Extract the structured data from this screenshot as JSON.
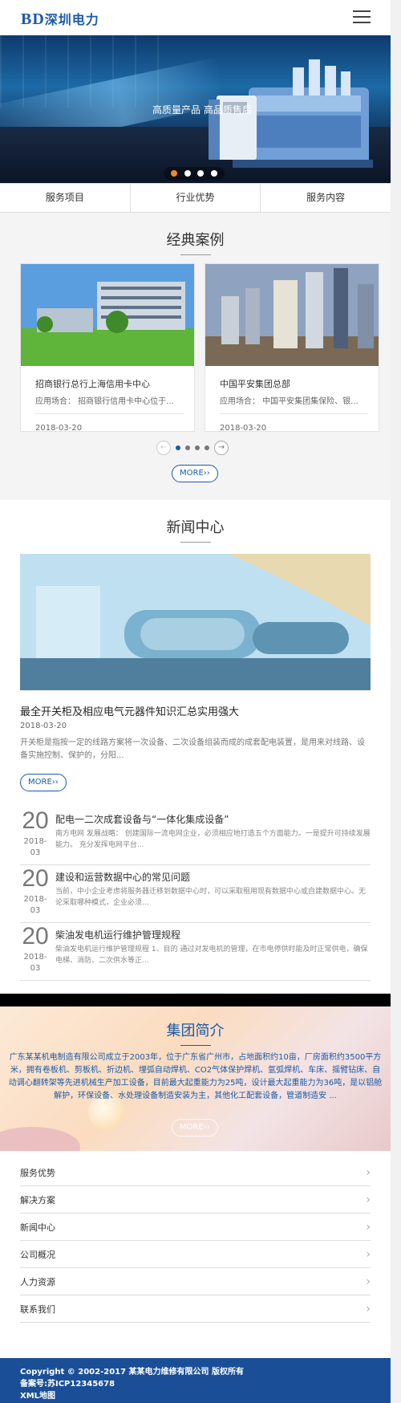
{
  "header": {
    "logo_latin": "BD",
    "logo_cn": "深圳电力"
  },
  "banner": {
    "tagline": "高质量产品 高品质售后",
    "slides": 5,
    "active_slide": 1
  },
  "tabs": [
    "服务项目",
    "行业优势",
    "服务内容"
  ],
  "cases": {
    "title": "经典案例",
    "items": [
      {
        "title": "招商银行总行上海信用卡中心",
        "desc": "应用场合： 招商银行信用卡中心位于...",
        "date": "2018-03-20"
      },
      {
        "title": "中国平安集团总部",
        "desc": "应用场合： 中国平安集团集保险、银...",
        "date": "2018-03-20"
      }
    ],
    "prev_icon": "←",
    "next_icon": "→",
    "more": "MORE››"
  },
  "news": {
    "title": "新闻中心",
    "featured": {
      "headline": "最全开关柜及相应电气元器件知识汇总实用强大",
      "date": "2018-03-20",
      "summary": "开关柜是指按一定的线路方案将一次设备、二次设备组装而成的成套配电装置，是用来对线路、设备实施控制、保护的，分阳..."
    },
    "more": "MORE››",
    "items": [
      {
        "day": "20",
        "ym": "2018-03",
        "title": "配电一二次成套设备与“一体化集成设备”",
        "desc": "南方电网 发展战略： 创建国际一流电网企业，必须相应地打造五个方面能力。一是提升可持续发展能力。 充分发挥电网平台..."
      },
      {
        "day": "20",
        "ym": "2018-03",
        "title": "建设和运营数据中心的常见问题",
        "desc": "当前，中小企业考虑将服务器迁移到数据中心时，可以采取租用现有数据中心或自建数据中心。无论采取哪种模式，企业必须..."
      },
      {
        "day": "20",
        "ym": "2018-03",
        "title": "柴油发电机运行维护管理规程",
        "desc": "柴油发电机运行维护管理规程 1、目的 通过对发电机的管理，在市电停供时能及时正常供电，确保电梯、消防、二次供水等正..."
      }
    ]
  },
  "about": {
    "title": "集团简介",
    "text": "广东某某机电制造有限公司成立于2003年，位于广东省广州市，占地面积约10亩，厂房面积约3500平方米，拥有卷板机、剪板机、折边机、埋弧自动焊机、CO2气体保护焊机、氩弧焊机、车床、摇臂钻床、自动调心翻转架等先进机械生产加工设备，目前最大起重能力为25吨，设计最大起重能力为36吨，是以铝舱解护，环保设备、水处理设备制造安装为主，其他化工配套设备，管道制造安 ...",
    "more": "MORE››"
  },
  "footnav": [
    "服务优势",
    "解决方案",
    "新闻中心",
    "公司概况",
    "人力资源",
    "联系我们"
  ],
  "chevron": "›",
  "footer": {
    "copyright": "Copyright © 2002-2017 某某电力维修有限公司 版权所有",
    "icp": "备案号:苏ICP12345678",
    "sitemap": "XML地图"
  }
}
